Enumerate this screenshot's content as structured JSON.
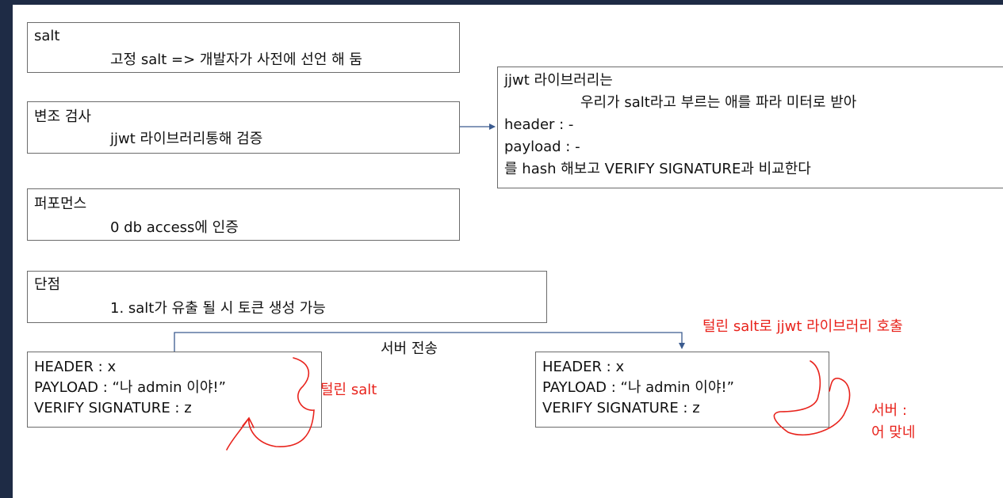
{
  "salt_box": {
    "title": "salt",
    "detail": "고정 salt => 개발자가 사전에 선언 해 둠"
  },
  "tamper_box": {
    "title": "변조 검사",
    "detail": "jjwt 라이브러리통해 검증"
  },
  "perf_box": {
    "title": "퍼포먼스",
    "detail": "0 db access에 인증"
  },
  "weakness_box": {
    "title": "단점",
    "detail": "1. salt가 유출 될 시 토큰 생성 가능"
  },
  "jjwt_box": {
    "line1": "jjwt 라이브러리는",
    "line2": "우리가 salt라고 부르는 애를 파라 미터로 받아",
    "line3": "header : -",
    "line4": "payload : -",
    "line5": "를 hash 해보고 VERIFY SIGNATURE과 비교한다"
  },
  "token_left": {
    "header": "HEADER : x",
    "payload": "PAYLOAD : “나 admin 이야!”",
    "signature": "VERIFY SIGNATURE : z"
  },
  "token_right": {
    "header": "HEADER : x",
    "payload": "PAYLOAD : “나 admin 이야!”",
    "signature": "VERIFY SIGNATURE : z"
  },
  "annotations": {
    "server_send": "서버 전송",
    "leaked_salt": "털린 salt",
    "call_library": "털린 salt로 jjwt 라이브러리 호출",
    "server_reply_1": "서버 :",
    "server_reply_2": "어 맞네"
  },
  "colors": {
    "sidebar": "#1e2b45",
    "annotation_red": "#e8231c",
    "border": "#6b6b6b",
    "connector": "#3b5b8f"
  }
}
